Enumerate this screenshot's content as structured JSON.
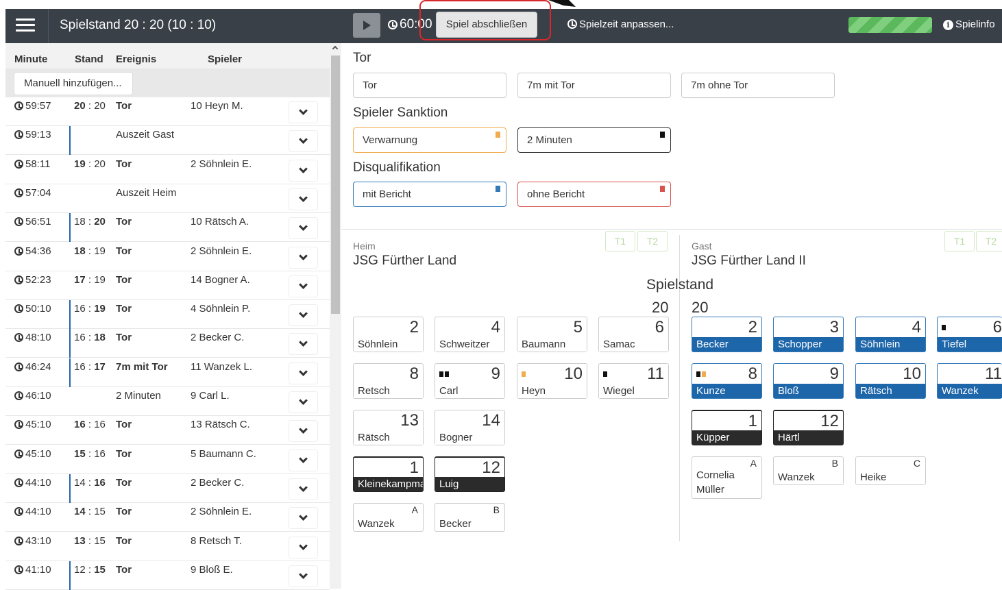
{
  "header": {
    "title": "Spielstand 20 : 20 (10 : 10)",
    "clock": "60:00",
    "end_button": "Spiel abschließen",
    "adjust_time": "Spielzeit anpassen...",
    "info": "Spielinfo",
    "progress_fraction": 1.0
  },
  "events_table": {
    "headers": {
      "minute": "Minute",
      "score": "Stand",
      "event": "Ereignis",
      "player": "Spieler"
    },
    "add_button": "Manuell hinzufügen...",
    "rows": [
      {
        "min": "59:57",
        "s1": "20",
        "s2": "20",
        "ev": "Tor",
        "pl": "10 Heyn M."
      },
      {
        "min": "59:13",
        "s1": "",
        "s2": "",
        "ev": "Auszeit Gast",
        "pl": ""
      },
      {
        "min": "58:11",
        "s1": "19",
        "s2": "20",
        "ev": "Tor",
        "pl": "2 Söhnlein E."
      },
      {
        "min": "57:04",
        "s1": "",
        "s2": "",
        "ev": "Auszeit Heim",
        "pl": ""
      },
      {
        "min": "56:51",
        "s1": "18",
        "s2": "20",
        "ev": "Tor",
        "pl": "10 Rätsch A."
      },
      {
        "min": "54:36",
        "s1": "18",
        "s2": "19",
        "ev": "Tor",
        "pl": "2 Söhnlein E."
      },
      {
        "min": "52:23",
        "s1": "17",
        "s2": "19",
        "ev": "Tor",
        "pl": "14 Bogner A."
      },
      {
        "min": "50:10",
        "s1": "16",
        "s2": "19",
        "ev": "Tor",
        "pl": "4 Söhnlein P."
      },
      {
        "min": "48:10",
        "s1": "16",
        "s2": "18",
        "ev": "Tor",
        "pl": "2 Becker C."
      },
      {
        "min": "46:24",
        "s1": "16",
        "s2": "17",
        "ev": "7m mit Tor",
        "pl": "11 Wanzek L."
      },
      {
        "min": "46:10",
        "s1": "",
        "s2": "",
        "ev": "2 Minuten",
        "pl": "9 Carl L."
      },
      {
        "min": "45:10",
        "s1": "16",
        "s2": "16",
        "ev": "Tor",
        "pl": "13 Rätsch C."
      },
      {
        "min": "45:10",
        "s1": "15",
        "s2": "16",
        "ev": "Tor",
        "pl": "5 Baumann C."
      },
      {
        "min": "44:10",
        "s1": "14",
        "s2": "16",
        "ev": "Tor",
        "pl": "2 Becker C."
      },
      {
        "min": "44:10",
        "s1": "14",
        "s2": "15",
        "ev": "Tor",
        "pl": "2 Söhnlein E."
      },
      {
        "min": "43:10",
        "s1": "13",
        "s2": "15",
        "ev": "Tor",
        "pl": "8 Retsch T."
      },
      {
        "min": "41:10",
        "s1": "12",
        "s2": "15",
        "ev": "Tor",
        "pl": "9 Bloß E."
      }
    ]
  },
  "actions": {
    "goal_heading": "Tor",
    "goal": "Tor",
    "seven_goal": "7m mit Tor",
    "seven_nogoal": "7m ohne Tor",
    "sanction_heading": "Spieler Sanktion",
    "warning": "Verwarnung",
    "two_min": "2 Minuten",
    "disq_heading": "Disqualifikation",
    "with_report": "mit Bericht",
    "without_report": "ohne Bericht"
  },
  "home": {
    "label": "Heim",
    "name": "JSG Fürther Land",
    "t1": "T1",
    "t2": "T2",
    "score": "20",
    "players": [
      {
        "num": "2",
        "name": "Söhnlein"
      },
      {
        "num": "4",
        "name": "Schweitzer"
      },
      {
        "num": "5",
        "name": "Baumann"
      },
      {
        "num": "6",
        "name": "Samac"
      },
      {
        "num": "8",
        "name": "Retsch"
      },
      {
        "num": "9",
        "name": "Carl"
      },
      {
        "num": "10",
        "name": "Heyn"
      },
      {
        "num": "11",
        "name": "Wiegel"
      },
      {
        "num": "13",
        "name": "Rätsch"
      },
      {
        "num": "14",
        "name": "Bogner"
      },
      {
        "num": "1",
        "name": "Kleinekampmann"
      },
      {
        "num": "12",
        "name": "Luig"
      }
    ],
    "officials": [
      {
        "letter": "A",
        "name": "Wanzek"
      },
      {
        "letter": "B",
        "name": "Becker"
      }
    ]
  },
  "score_heading": "Spielstand",
  "guest": {
    "label": "Gast",
    "name": "JSG Fürther Land II",
    "t1": "T1",
    "t2": "T2",
    "score": "20",
    "players": [
      {
        "num": "2",
        "name": "Becker"
      },
      {
        "num": "3",
        "name": "Schopper"
      },
      {
        "num": "4",
        "name": "Söhnlein"
      },
      {
        "num": "6",
        "name": "Tiefel"
      },
      {
        "num": "8",
        "name": "Kunze"
      },
      {
        "num": "9",
        "name": "Bloß"
      },
      {
        "num": "10",
        "name": "Rätsch"
      },
      {
        "num": "11",
        "name": "Wanzek"
      },
      {
        "num": "1",
        "name": "Küpper"
      },
      {
        "num": "12",
        "name": "Härtl"
      }
    ],
    "officials": [
      {
        "letter": "A",
        "name": "Cornelia Müller"
      },
      {
        "letter": "B",
        "name": "Wanzek"
      },
      {
        "letter": "C",
        "name": "Heike"
      }
    ]
  }
}
